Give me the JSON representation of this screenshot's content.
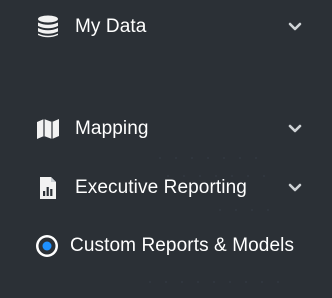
{
  "sidebar": {
    "items": [
      {
        "label": "My Data",
        "icon": "database-icon",
        "expandable": true
      },
      {
        "label": "Mapping",
        "icon": "map-icon",
        "expandable": true
      },
      {
        "label": "Executive Reporting",
        "icon": "report-chart-icon",
        "expandable": true
      },
      {
        "label": "Custom Reports & Models",
        "icon": "radio-selected-icon",
        "expandable": false,
        "selected": true
      }
    ]
  },
  "colors": {
    "background": "#2b3036",
    "text": "#ffffff",
    "icon": "#f2f2f2",
    "chevron": "#cfd3d6",
    "radio_accent": "#1e90ff"
  }
}
